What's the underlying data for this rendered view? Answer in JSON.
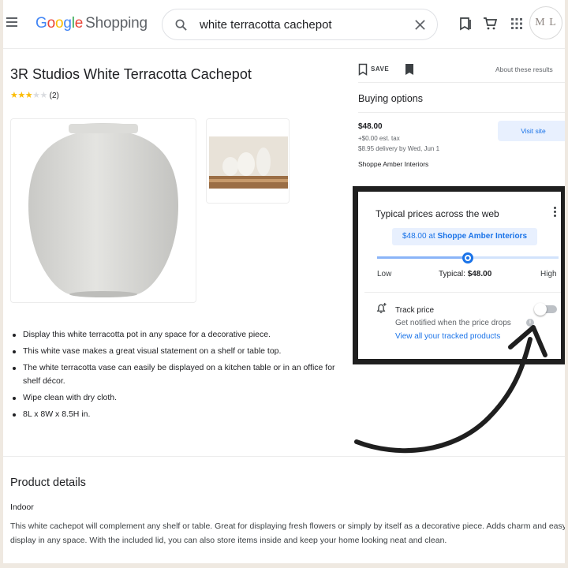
{
  "header": {
    "logo_google": [
      "G",
      "o",
      "o",
      "g",
      "l",
      "e"
    ],
    "logo_product": "Shopping",
    "search_query": "white terracotta cachepot",
    "avatar_initials": "M L"
  },
  "product": {
    "title": "3R Studios White Terracotta Cachepot",
    "rating_stars": 3,
    "rating_count": "(2)",
    "description": [
      "Display this white terracotta pot in any space for a decorative piece.",
      "This white vase makes a great visual statement on a shelf or table top.",
      "The white terracotta vase can easily be displayed on a kitchen table or in an office for shelf décor.",
      "Wipe clean with dry cloth.",
      "8L x 8W x 8.5H in."
    ]
  },
  "details": {
    "title": "Product details",
    "subtitle": "Indoor",
    "text": "This white cachepot will complement any shelf or table. Great for displaying fresh flowers or simply by itself as a decorative piece. Adds charm and easy to display in any space. With the included lid, you can also store items inside and keep your home looking neat and clean."
  },
  "actions": {
    "save_label": "SAVE",
    "about_label": "About these results"
  },
  "buying": {
    "title": "Buying options",
    "price": "$48.00",
    "tax": "+$0.00 est. tax",
    "delivery": "$8.95 delivery by Wed, Jun 1",
    "seller": "Shoppe Amber Interiors",
    "visit_label": "Visit site"
  },
  "typical_prices": {
    "title": "Typical prices across the web",
    "chip_price": "$48.00 at",
    "chip_store": "Shoppe Amber Interiors",
    "low_label": "Low",
    "typical_label": "Typical:",
    "typical_value": "$48.00",
    "high_label": "High",
    "marker_fraction": 0.5
  },
  "track": {
    "label": "Track price",
    "sublabel": "Get notified when the price drops",
    "link": "View all your tracked products",
    "enabled": false
  },
  "colors": {
    "accent": "#1a73e8",
    "star": "#fbbc04",
    "annotation": "#1f1f1f"
  }
}
